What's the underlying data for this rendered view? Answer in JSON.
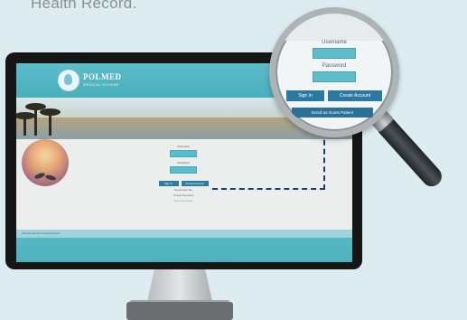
{
  "headline": "Health Record.",
  "site": {
    "brand": "POLMED",
    "brand_sub": "MEDICAL SCHEME",
    "login": {
      "username_label": "Username",
      "password_label": "Password",
      "sign_in_label": "Sign In",
      "create_account_label": "Create Account",
      "remember_label": "Remember Me",
      "forgot_label": "Forgot Password",
      "register_label": "Enroll as Guest"
    },
    "footer_text": "Polmed Member Health Record"
  },
  "magnifier": {
    "username_label": "Username",
    "password_label": "Password",
    "sign_in_label": "Sign In",
    "create_account_label": "Create Account",
    "wide_button_label": "Enroll as Guest Patient"
  },
  "colors": {
    "teal": "#5bbdc9",
    "button_blue": "#2c7ea0",
    "dash": "#1b3d6a",
    "background": "#dcecf1"
  }
}
